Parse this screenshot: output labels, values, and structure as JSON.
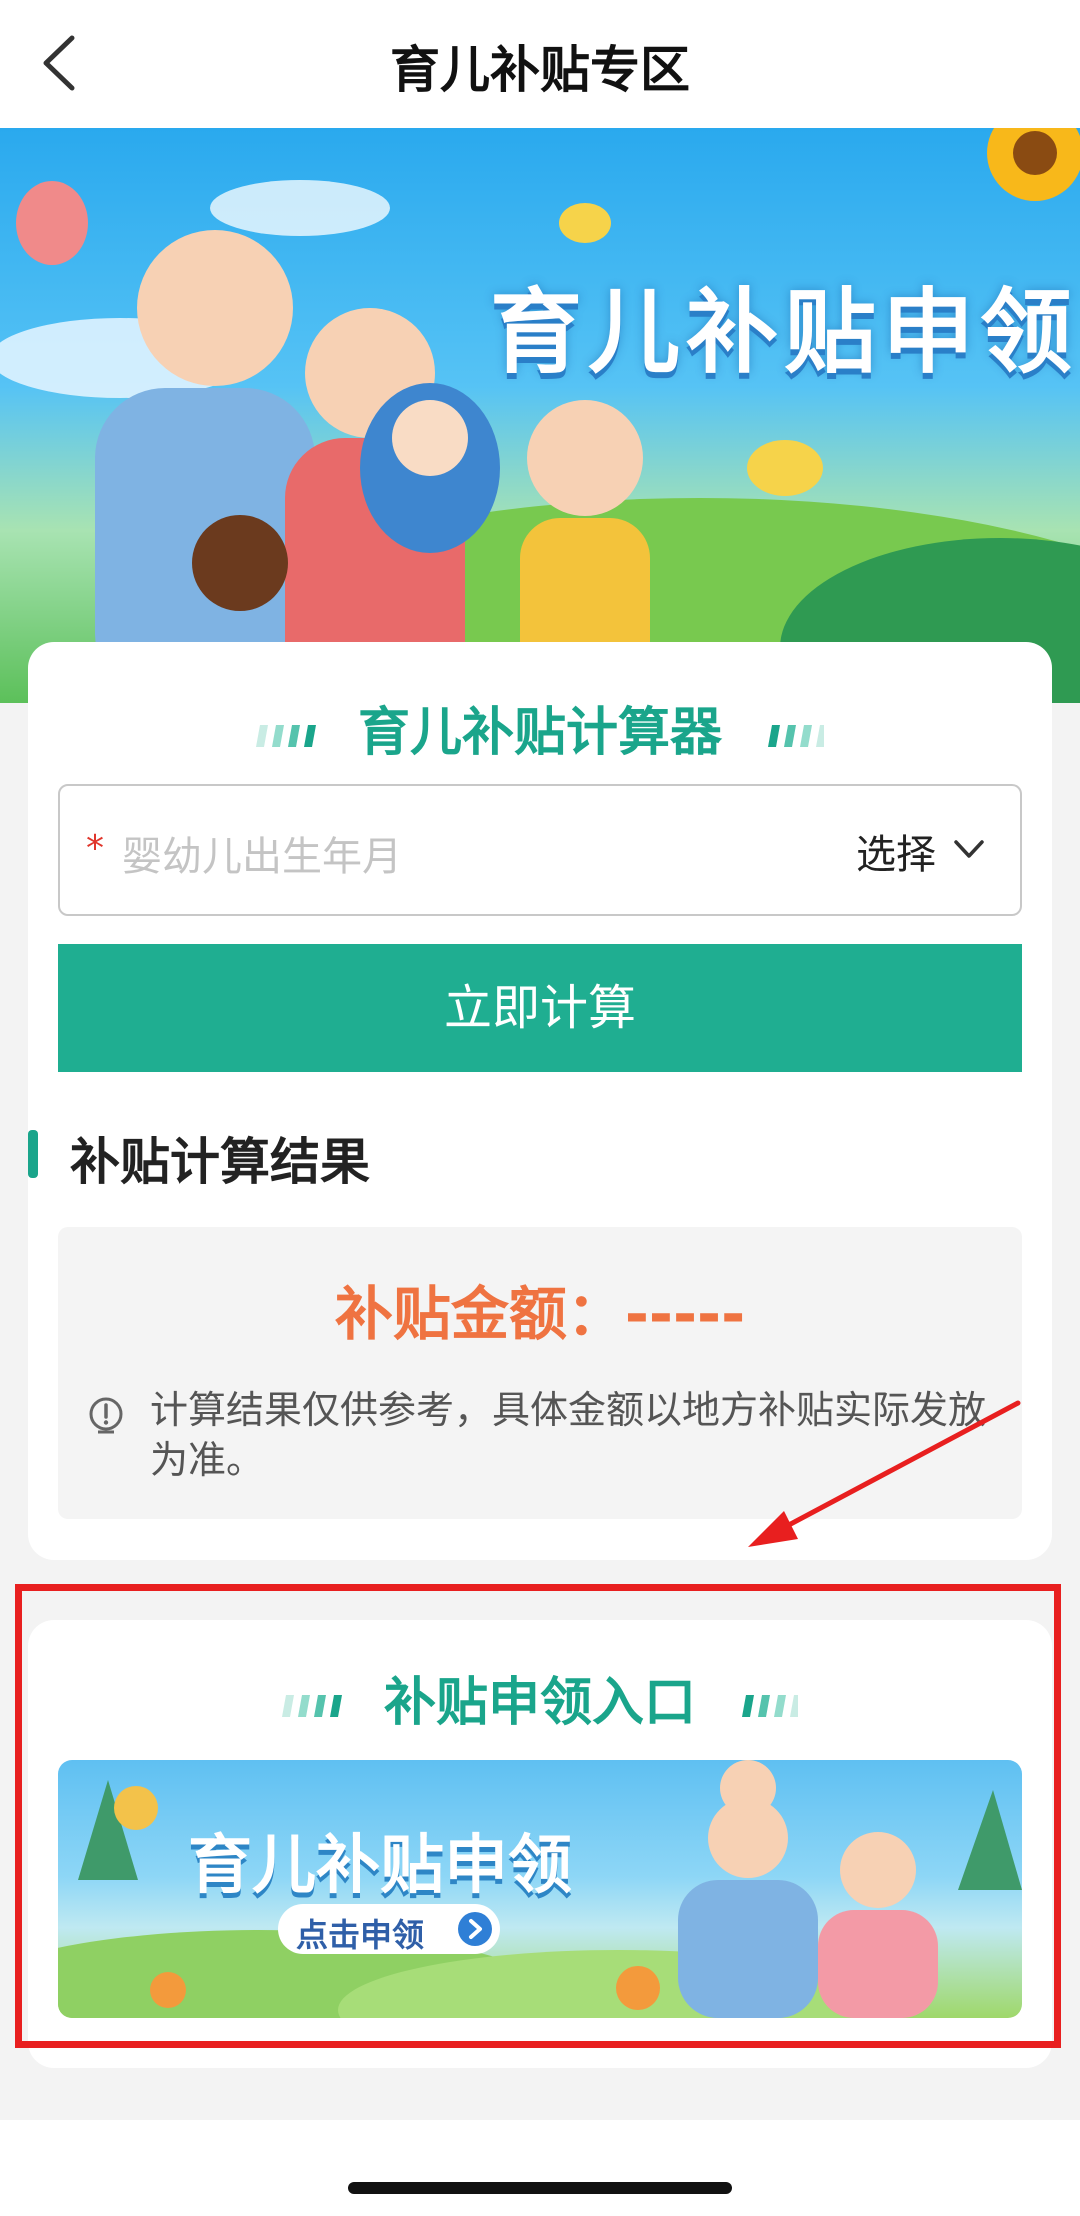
{
  "header": {
    "title": "育儿补贴专区",
    "back_icon": "chevron-left-icon"
  },
  "hero": {
    "title": "育儿补贴申领"
  },
  "calculator": {
    "title": "育儿补贴计算器",
    "required_mark": "*",
    "birth_placeholder": "婴幼儿出生年月",
    "select_label": "选择",
    "calc_button": "立即计算",
    "result_title": "补贴计算结果",
    "amount_text": "补贴金额：-----",
    "note": "计算结果仅供参考，具体金额以地方补贴实际发放为准。"
  },
  "entry": {
    "title": "补贴申领入口",
    "banner_title": "育儿补贴申领",
    "banner_button": "点击申领"
  },
  "colors": {
    "accent": "#1fae91",
    "amount": "#ef7341",
    "highlight": "#e81f1f"
  }
}
